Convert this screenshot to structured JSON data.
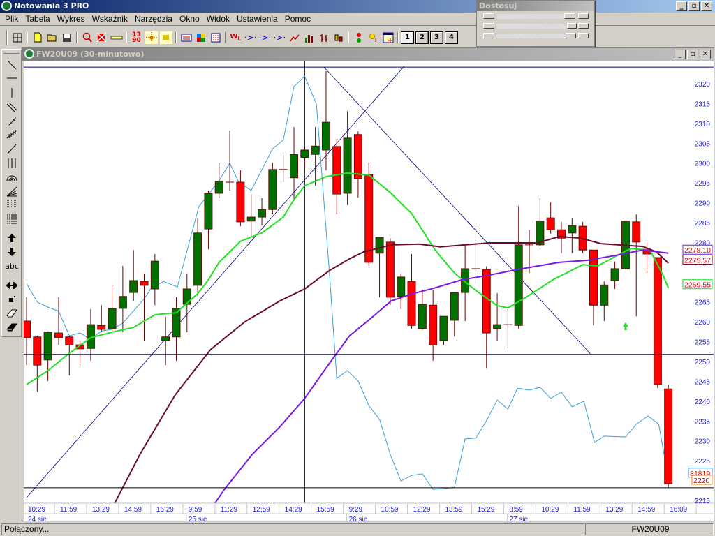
{
  "app": {
    "title": "Notowania 3 PRO"
  },
  "menu": [
    "Plik",
    "Tabela",
    "Wykres",
    "Wskaźnik",
    "Narzędzia",
    "Okno",
    "Widok",
    "Ustawienia",
    "Pomoc"
  ],
  "toolbar": {
    "groups": [
      [
        "grid-icon"
      ],
      [
        "new-file-icon",
        "open-folder-icon",
        "save-icon"
      ],
      [
        "zoom-icon",
        "delete-chart-icon",
        "ruler-icon"
      ],
      [
        "numbers-icon",
        "crosshair-icon",
        "dots-icon"
      ],
      [
        "table-icon",
        "color-table-icon",
        "list-icon"
      ],
      [
        "wl-icon",
        "arrow-indicator-red-icon",
        "arrow-indicator-blue-icon",
        "arrow-indicator-icon",
        "line-chart-icon",
        "bar-chart-icon",
        "ohlc-chart-icon",
        "candle-chart-icon"
      ],
      [
        "signal-icon",
        "add-alert-icon",
        "add-window-icon"
      ]
    ],
    "layouts": [
      "1",
      "2",
      "3",
      "4"
    ]
  },
  "adjust_panel": {
    "title": "Dostosuj"
  },
  "left_tools": [
    "trendline-icon",
    "horizontal-line-icon",
    "vertical-line-icon",
    "parallel-lines-icon",
    "fan-lines-icon",
    "ticks-line-icon",
    "ray-icon",
    "vertical-lines-icon",
    "fibonacci-arcs-icon",
    "fibonacci-fan-icon",
    "fibonacci-retracement-icon",
    "time-zones-icon",
    "buy-arrow-icon",
    "sell-arrow-icon",
    "text-tool-icon",
    "double-arrow-icon",
    "move-icon",
    "eraser-icon",
    "eraser-all-icon"
  ],
  "left_tools_text": {
    "text_tool": "abc"
  },
  "chart_window": {
    "title": "FW20U09 (30-minutowo)"
  },
  "status": {
    "text": "Połączony...",
    "symbol": "FW20U09"
  },
  "chart_data": {
    "type": "candlestick",
    "symbol": "FW20U09",
    "interval": "30-minutowo",
    "ylim": [
      2214,
      2325
    ],
    "yticks": [
      2320,
      2315,
      2310,
      2305,
      2300,
      2295,
      2290,
      2285,
      2280,
      2275,
      2270,
      2265,
      2260,
      2255,
      2250,
      2245,
      2240,
      2235,
      2230,
      2225,
      2220,
      2215
    ],
    "colors": {
      "up": "#007000",
      "down": "#ff0000",
      "wick": "#6b0000",
      "axis_text": "#2020c0",
      "drawing": "#000080"
    },
    "x_labels": [
      "10:29",
      "11:59",
      "13:29",
      "14:59",
      "16:29",
      "9:59",
      "11:29",
      "12:59",
      "14:29",
      "15:59",
      "9:29",
      "10:59",
      "12:29",
      "13:59",
      "15:29",
      "8:59",
      "10:29",
      "11:59",
      "13:29",
      "14:59",
      "16:09"
    ],
    "x_label_step": 3,
    "days": [
      {
        "label": "24 sie",
        "bar": 0
      },
      {
        "label": "25 sie",
        "bar": 15
      },
      {
        "label": "26 sie",
        "bar": 30
      },
      {
        "label": "27 sie",
        "bar": 45
      }
    ],
    "ohlc": [
      [
        2260.2,
        2266.2,
        2249.1,
        2256
      ],
      [
        2256.2,
        2256.5,
        2242.4,
        2249.1
      ],
      [
        2250.4,
        2257.6,
        2245.1,
        2257.4
      ],
      [
        2257.2,
        2266.2,
        2254.2,
        2256
      ],
      [
        2256.2,
        2256.5,
        2246.5,
        2254.2
      ],
      [
        2254.2,
        2255.3,
        2249.1,
        2253.2
      ],
      [
        2253.3,
        2263.2,
        2250.2,
        2259.3
      ],
      [
        2259.1,
        2264.2,
        2257.4,
        2258.1
      ],
      [
        2258.3,
        2269.2,
        2257.4,
        2263.4
      ],
      [
        2263.4,
        2274.1,
        2257.4,
        2266.4
      ],
      [
        2267.4,
        2278.1,
        2265.3,
        2270.4
      ],
      [
        2270.2,
        2272.2,
        2255.3,
        2269.2
      ],
      [
        2268.3,
        2277.1,
        2264.2,
        2275.3
      ],
      [
        2255.3,
        2261.3,
        2249.1,
        2256.2
      ],
      [
        2256.2,
        2266.2,
        2250.2,
        2263.4
      ],
      [
        2264.4,
        2272.2,
        2257.4,
        2268.3
      ],
      [
        2269.2,
        2286.2,
        2266.5,
        2282.4
      ],
      [
        2283.4,
        2293.1,
        2278.3,
        2292.4
      ],
      [
        2292.4,
        2300.1,
        2291.2,
        2295.4
      ],
      [
        2295.2,
        2308.2,
        2293.1,
        2295.2
      ],
      [
        2295.2,
        2298.2,
        2284.1,
        2285.2
      ],
      [
        2285.4,
        2292.2,
        2281.3,
        2286.4
      ],
      [
        2286.4,
        2291.2,
        2284.3,
        2288.3
      ],
      [
        2288.3,
        2300.1,
        2287.1,
        2298.4
      ],
      [
        2298.4,
        2302.1,
        2295.2,
        2298.4
      ],
      [
        2296.3,
        2309.1,
        2290.5,
        2302.2
      ],
      [
        2301.4,
        2304,
        2299,
        2303.3
      ],
      [
        2302.2,
        2309.1,
        2294.3,
        2304.3
      ],
      [
        2303.3,
        2323.2,
        2298.2,
        2310.3
      ],
      [
        2304.2,
        2306.1,
        2287.1,
        2292.2
      ],
      [
        2292.4,
        2313.1,
        2289.4,
        2306.3
      ],
      [
        2307.2,
        2308,
        2291.3,
        2296.1
      ],
      [
        2297.1,
        2300.1,
        2274.1,
        2275
      ],
      [
        2277.3,
        2281.4,
        2266.2,
        2281.3
      ],
      [
        2280.1,
        2281.1,
        2264.2,
        2266.2
      ],
      [
        2266.4,
        2272.2,
        2263.2,
        2271.3
      ],
      [
        2270.2,
        2277.1,
        2258.3,
        2259.1
      ],
      [
        2258.3,
        2268.1,
        2258,
        2264.4
      ],
      [
        2264.2,
        2268.1,
        2250.2,
        2254.2
      ],
      [
        2255.3,
        2261.4,
        2254.2,
        2261.4
      ],
      [
        2260.4,
        2267.4,
        2256.3,
        2267.4
      ],
      [
        2267.4,
        2279.2,
        2260.2,
        2273.4
      ],
      [
        2273.4,
        2283.6,
        2269.4,
        2273.4
      ],
      [
        2273.2,
        2274,
        2248.2,
        2257.2
      ],
      [
        2258.3,
        2267.2,
        2255.3,
        2259.3
      ],
      [
        2259.3,
        2263.2,
        2253.3,
        2259.3
      ],
      [
        2259.1,
        2289.2,
        2258.3,
        2279.4
      ],
      [
        2279.4,
        2283.2,
        2272.3,
        2279.4
      ],
      [
        2279.4,
        2291.2,
        2279,
        2285.4
      ],
      [
        2286.2,
        2290.1,
        2282.2,
        2283.2
      ],
      [
        2283.2,
        2285.2,
        2277.3,
        2281.1
      ],
      [
        2282.4,
        2286.2,
        2277.3,
        2284.3
      ],
      [
        2284.1,
        2285.2,
        2277.3,
        2278.1
      ],
      [
        2278.1,
        2278.1,
        2259.1,
        2264.2
      ],
      [
        2264.2,
        2270.2,
        2260.2,
        2269.3
      ],
      [
        2270.4,
        2275.2,
        2268.3,
        2273.4
      ],
      [
        2273.4,
        2285.4,
        2273.4,
        2285.4
      ],
      [
        2285.2,
        2287.1,
        2261.4,
        2280.1
      ],
      [
        2278.3,
        2280.1,
        2272.3,
        2277.1
      ],
      [
        2276.2,
        2276.2,
        2243.3,
        2244.2
      ],
      [
        2243.1,
        2244.2,
        2218.3,
        2219.2
      ]
    ],
    "overlays": [
      {
        "color": "#22e022",
        "width": 2,
        "last_label": "2269.55",
        "points": [
          [
            0,
            2244.2
          ],
          [
            2,
            2247.7
          ],
          [
            4,
            2252.1
          ],
          [
            6,
            2256
          ],
          [
            8,
            2257.4
          ],
          [
            10,
            2258.6
          ],
          [
            12,
            2261.8
          ],
          [
            14,
            2262.3
          ],
          [
            16,
            2267.1
          ],
          [
            17,
            2270.6
          ],
          [
            18,
            2275
          ],
          [
            20,
            2280.3
          ],
          [
            22,
            2282.4
          ],
          [
            24,
            2286.4
          ],
          [
            25,
            2290.8
          ],
          [
            26,
            2294.3
          ],
          [
            28,
            2296.6
          ],
          [
            30,
            2297.5
          ],
          [
            32,
            2297
          ],
          [
            34,
            2292.6
          ],
          [
            36,
            2287.3
          ],
          [
            38.2,
            2278.1
          ],
          [
            40,
            2272.3
          ],
          [
            42,
            2267.9
          ],
          [
            44,
            2264.1
          ],
          [
            45,
            2263.5
          ],
          [
            46.7,
            2266.2
          ],
          [
            49.2,
            2270.6
          ],
          [
            52,
            2274.4
          ],
          [
            53.4,
            2274.1
          ],
          [
            55.2,
            2276.7
          ],
          [
            56.5,
            2278.5
          ],
          [
            58.3,
            2278
          ],
          [
            59.5,
            2271.8
          ],
          [
            60,
            2268.5
          ]
        ]
      },
      {
        "color": "#6b0a2a",
        "width": 2,
        "last_label": "2275.57",
        "points": [
          [
            7.4,
            2209.9
          ],
          [
            10.6,
            2226.6
          ],
          [
            13.9,
            2241.6
          ],
          [
            17.2,
            2253
          ],
          [
            20.4,
            2260
          ],
          [
            23.7,
            2265.3
          ],
          [
            26,
            2268.3
          ],
          [
            28.3,
            2272.9
          ],
          [
            30.2,
            2275.9
          ],
          [
            31.5,
            2277.6
          ],
          [
            34.1,
            2279.4
          ],
          [
            36.7,
            2279.6
          ],
          [
            38.7,
            2278.9
          ],
          [
            43.3,
            2279.9
          ],
          [
            47.8,
            2279.9
          ],
          [
            49.8,
            2281.5
          ],
          [
            51.8,
            2281.1
          ],
          [
            53.7,
            2279.7
          ],
          [
            57.6,
            2279
          ],
          [
            58.9,
            2277.6
          ],
          [
            60,
            2274.8
          ]
        ]
      },
      {
        "color": "#7a18e0",
        "width": 2,
        "last_label": "2278.10",
        "points": [
          [
            16.5,
            2209.9
          ],
          [
            18.5,
            2217.8
          ],
          [
            21.1,
            2226.6
          ],
          [
            23.7,
            2233.6
          ],
          [
            26,
            2240.7
          ],
          [
            28.3,
            2249.5
          ],
          [
            30.2,
            2256.5
          ],
          [
            32.2,
            2260.9
          ],
          [
            34.1,
            2265.3
          ],
          [
            36.1,
            2267.1
          ],
          [
            38.1,
            2268.5
          ],
          [
            40.7,
            2270.6
          ],
          [
            43.3,
            2271.8
          ],
          [
            45.9,
            2273.2
          ],
          [
            49.8,
            2275
          ],
          [
            52.4,
            2275.5
          ],
          [
            55,
            2276.7
          ],
          [
            57.6,
            2278.1
          ],
          [
            60,
            2277.3
          ]
        ]
      },
      {
        "color": "#3aa0d8",
        "width": 1,
        "last_label": "81819",
        "points": [
          [
            0,
            2269.7
          ],
          [
            1,
            2265
          ],
          [
            2,
            2263.7
          ],
          [
            3,
            2262.7
          ],
          [
            4,
            2256.5
          ],
          [
            5,
            2257.2
          ],
          [
            6,
            2255.6
          ],
          [
            7,
            2257.7
          ],
          [
            8,
            2258.1
          ],
          [
            9,
            2259.7
          ],
          [
            11,
            2265.8
          ],
          [
            11.6,
            2268.3
          ],
          [
            12.8,
            2270.2
          ],
          [
            14.1,
            2268.8
          ],
          [
            15.2,
            2279.9
          ],
          [
            16.1,
            2289
          ],
          [
            18,
            2295.6
          ],
          [
            19,
            2300
          ],
          [
            19.8,
            2295.4
          ],
          [
            21,
            2293.1
          ],
          [
            23,
            2303.6
          ],
          [
            24,
            2305.8
          ],
          [
            25,
            2319.3
          ],
          [
            26,
            2321.9
          ],
          [
            27.1,
            2314.9
          ],
          [
            28.3,
            2272.9
          ],
          [
            29,
            2245.8
          ],
          [
            30,
            2247.7
          ],
          [
            31,
            2245.1
          ],
          [
            32,
            2238.9
          ],
          [
            33,
            2235.4
          ],
          [
            34,
            2226.6
          ],
          [
            35,
            2219.9
          ],
          [
            36,
            2221.3
          ],
          [
            37,
            2221.7
          ],
          [
            38,
            2217.8
          ],
          [
            39,
            2218
          ],
          [
            40,
            2218.3
          ],
          [
            41,
            2230.5
          ],
          [
            42,
            2230.7
          ],
          [
            43,
            2235.1
          ],
          [
            44,
            2240.3
          ],
          [
            45,
            2238
          ],
          [
            45.9,
            2243.3
          ],
          [
            47,
            2242.8
          ],
          [
            48,
            2243.5
          ],
          [
            49,
            2240.7
          ],
          [
            50,
            2242.3
          ],
          [
            51,
            2238.6
          ],
          [
            52.1,
            2240
          ],
          [
            53.1,
            2229.6
          ],
          [
            54,
            2231.2
          ],
          [
            56,
            2231
          ],
          [
            57,
            2234.2
          ],
          [
            58.1,
            2236.3
          ],
          [
            59.1,
            2234.2
          ],
          [
            59.6,
            2226.6
          ]
        ]
      }
    ],
    "last_price_label": {
      "text": "2220",
      "color": "#ff8000"
    },
    "drawings": {
      "trendlines": [
        [
          [
            0,
            2215.7
          ],
          [
            35.3,
            2324.4
          ]
        ],
        [
          [
            27.8,
            2324.2
          ],
          [
            52.7,
            2252
          ]
        ]
      ],
      "horizontal_levels": [
        2324.2,
        2251.8,
        2218.2
      ],
      "vertical_line_bar": 26,
      "buy_arrow": {
        "bar": 56,
        "price": 2258.8,
        "color": "#22e022"
      }
    }
  }
}
